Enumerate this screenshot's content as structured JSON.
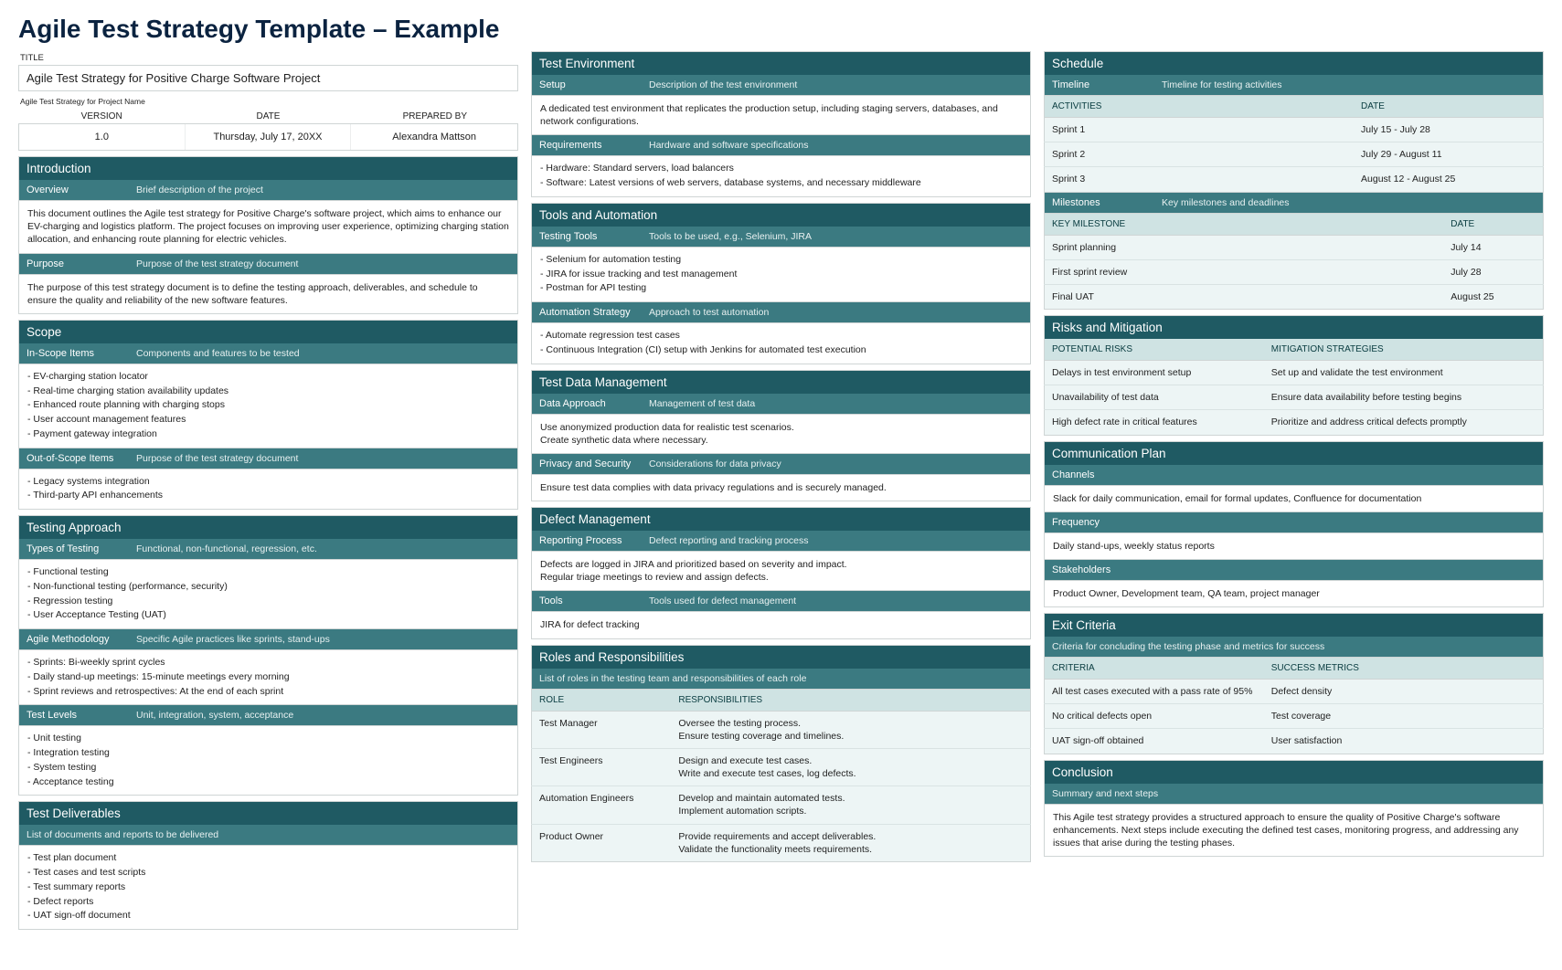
{
  "page_title": "Agile Test Strategy Template – Example",
  "title_label": "TITLE",
  "title_value": "Agile Test Strategy for Positive Charge Software Project",
  "title_hint": "Agile Test Strategy for Project Name",
  "meta_headers": {
    "version": "VERSION",
    "date": "DATE",
    "prepared_by": "PREPARED BY"
  },
  "meta_values": {
    "version": "1.0",
    "date": "Thursday, July 17, 20XX",
    "prepared_by": "Alexandra Mattson"
  },
  "introduction": {
    "title": "Introduction",
    "overview_label": "Overview",
    "overview_hint": "Brief description of the project",
    "overview_text": "This document outlines the Agile test strategy for Positive Charge's software project, which aims to enhance our EV-charging and logistics platform. The project focuses on improving user experience, optimizing charging station allocation, and enhancing route planning for electric vehicles.",
    "purpose_label": "Purpose",
    "purpose_hint": "Purpose of the test strategy document",
    "purpose_text": "The purpose of this test strategy document is to define the testing approach, deliverables, and schedule to ensure the quality and reliability of the new software features."
  },
  "scope": {
    "title": "Scope",
    "in_label": "In-Scope Items",
    "in_hint": "Components and features to be tested",
    "in_items": [
      "EV-charging station locator",
      "Real-time charging station availability updates",
      "Enhanced route planning with charging stops",
      "User account management features",
      "Payment gateway integration"
    ],
    "out_label": "Out-of-Scope Items",
    "out_hint": "Purpose of the test strategy document",
    "out_items": [
      "Legacy systems integration",
      "Third-party API enhancements"
    ]
  },
  "approach": {
    "title": "Testing Approach",
    "types_label": "Types of Testing",
    "types_hint": "Functional, non-functional, regression, etc.",
    "types_items": [
      "Functional testing",
      "Non-functional testing (performance, security)",
      "Regression testing",
      "User Acceptance Testing (UAT)"
    ],
    "agile_label": "Agile Methodology",
    "agile_hint": "Specific Agile practices like sprints, stand-ups",
    "agile_items": [
      "Sprints: Bi-weekly sprint cycles",
      "Daily stand-up meetings: 15-minute meetings every morning",
      "Sprint reviews and retrospectives: At the end of each sprint"
    ],
    "levels_label": "Test Levels",
    "levels_hint": "Unit, integration, system, acceptance",
    "levels_items": [
      "Unit testing",
      "Integration testing",
      "System testing",
      "Acceptance testing"
    ]
  },
  "deliverables": {
    "title": "Test Deliverables",
    "hint": "List of documents and reports to be delivered",
    "items": [
      "Test plan document",
      "Test cases and test scripts",
      "Test summary reports",
      "Defect reports",
      "UAT sign-off document"
    ]
  },
  "environment": {
    "title": "Test Environment",
    "setup_label": "Setup",
    "setup_hint": "Description of the test environment",
    "setup_text": "A dedicated test environment that replicates the production setup, including staging servers, databases, and network configurations.",
    "req_label": "Requirements",
    "req_hint": "Hardware and software specifications",
    "req_items": [
      "Hardware: Standard servers, load balancers",
      "Software: Latest versions of web servers, database systems, and necessary middleware"
    ]
  },
  "tools": {
    "title": "Tools and Automation",
    "testing_label": "Testing Tools",
    "testing_hint": "Tools to be used, e.g., Selenium, JIRA",
    "testing_items": [
      "Selenium for automation testing",
      "JIRA for issue tracking and test management",
      "Postman for API testing"
    ],
    "auto_label": "Automation Strategy",
    "auto_hint": "Approach to test automation",
    "auto_items": [
      "Automate regression test cases",
      "Continuous Integration (CI) setup with Jenkins for automated test execution"
    ]
  },
  "testdata": {
    "title": "Test Data Management",
    "data_label": "Data Approach",
    "data_hint": "Management of test data",
    "data_text1": "Use anonymized production data for realistic test scenarios.",
    "data_text2": "Create synthetic data where necessary.",
    "privacy_label": "Privacy and Security",
    "privacy_hint": "Considerations for data privacy",
    "privacy_text": "Ensure test data complies with data privacy regulations and is securely managed."
  },
  "defect": {
    "title": "Defect Management",
    "rep_label": "Reporting Process",
    "rep_hint": "Defect reporting and tracking process",
    "rep_text1": "Defects are logged in JIRA and prioritized based on severity and impact.",
    "rep_text2": "Regular triage meetings to review and assign defects.",
    "tools_label": "Tools",
    "tools_hint": "Tools used for defect management",
    "tools_text": "JIRA for defect tracking"
  },
  "roles": {
    "title": "Roles and Responsibilities",
    "hint": "List of roles in the testing team and responsibilities of each role",
    "headers": {
      "role": "ROLE",
      "resp": "RESPONSIBILITIES"
    },
    "rows": [
      {
        "role": "Test Manager",
        "line1": "Oversee the testing process.",
        "line2": "Ensure testing coverage and timelines."
      },
      {
        "role": "Test Engineers",
        "line1": "Design and execute test cases.",
        "line2": "Write and execute test cases, log defects."
      },
      {
        "role": "Automation Engineers",
        "line1": "Develop and maintain automated tests.",
        "line2": "Implement automation scripts."
      },
      {
        "role": "Product Owner",
        "line1": "Provide requirements and accept deliverables.",
        "line2": "Validate the functionality meets requirements."
      }
    ]
  },
  "schedule": {
    "title": "Schedule",
    "tl_label": "Timeline",
    "tl_hint": "Timeline for testing activities",
    "act_headers": {
      "activities": "ACTIVITIES",
      "date": "DATE"
    },
    "act_rows": [
      {
        "a": "Sprint 1",
        "d": "July 15 - July 28"
      },
      {
        "a": "Sprint 2",
        "d": "July 29 - August 11"
      },
      {
        "a": "Sprint 3",
        "d": "August 12 - August 25"
      }
    ],
    "ms_label": "Milestones",
    "ms_hint": "Key milestones and deadlines",
    "ms_headers": {
      "milestone": "KEY MILESTONE",
      "date": "DATE"
    },
    "ms_rows": [
      {
        "m": "Sprint planning",
        "d": "July 14"
      },
      {
        "m": "First sprint review",
        "d": "July 28"
      },
      {
        "m": "Final UAT",
        "d": "August 25"
      }
    ]
  },
  "risks": {
    "title": "Risks and Mitigation",
    "headers": {
      "risk": "POTENTIAL RISKS",
      "mit": "MITIGATION STRATEGIES"
    },
    "rows": [
      {
        "r": "Delays in test environment setup",
        "m": "Set up and validate the test environment"
      },
      {
        "r": "Unavailability of test data",
        "m": "Ensure data availability before testing begins"
      },
      {
        "r": "High defect rate in critical features",
        "m": "Prioritize and address critical defects promptly"
      }
    ]
  },
  "comm": {
    "title": "Communication Plan",
    "channels_label": "Channels",
    "channels_text": "Slack for daily communication, email for formal updates, Confluence for documentation",
    "freq_label": "Frequency",
    "freq_text": "Daily stand-ups, weekly status reports",
    "stake_label": "Stakeholders",
    "stake_text": "Product Owner, Development team, QA team, project manager"
  },
  "exit": {
    "title": "Exit Criteria",
    "hint": "Criteria for concluding the testing phase and metrics for success",
    "headers": {
      "criteria": "CRITERIA",
      "metrics": "SUCCESS METRICS"
    },
    "rows": [
      {
        "c": "All test cases executed with a pass rate of 95%",
        "m": "Defect density"
      },
      {
        "c": "No critical defects open",
        "m": "Test coverage"
      },
      {
        "c": "UAT sign-off obtained",
        "m": "User satisfaction"
      }
    ]
  },
  "conclusion": {
    "title": "Conclusion",
    "hint": "Summary and next steps",
    "text": "This Agile test strategy provides a structured approach to ensure the quality of Positive Charge's software enhancements. Next steps include executing the defined test cases, monitoring progress, and addressing any issues that arise during the testing phases."
  }
}
